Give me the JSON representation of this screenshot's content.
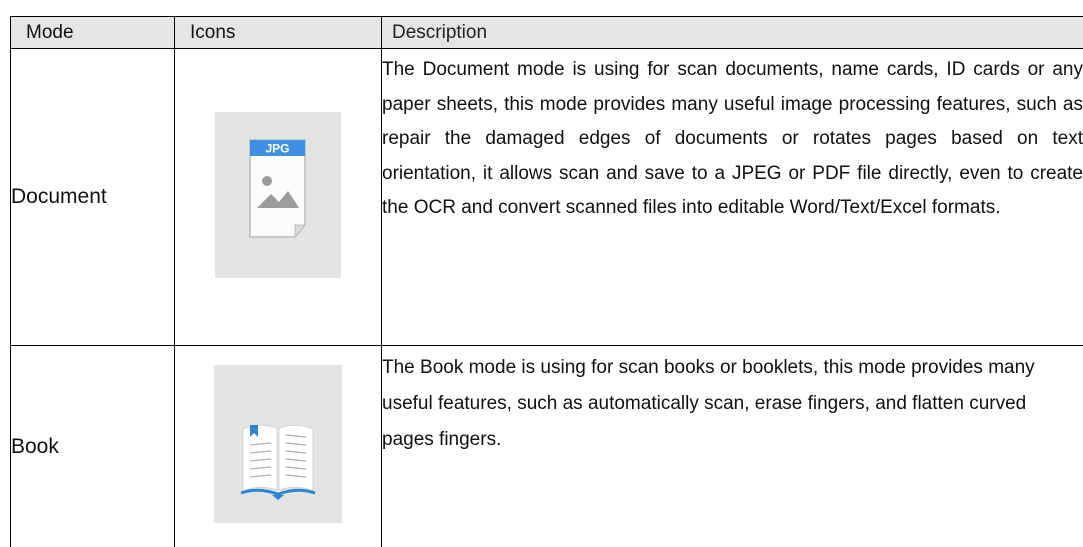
{
  "table": {
    "headers": {
      "mode": "Mode",
      "icons": "Icons",
      "description": "Description"
    },
    "rows": [
      {
        "mode": "Document",
        "icon": "jpg-file-icon",
        "icon_badge": "JPG",
        "description": "The Document mode is using for scan documents, name cards, ID cards or any paper sheets, this mode provides many useful image processing features, such as repair the damaged edges of documents or rotates pages based on text orientation, it allows scan and save to a JPEG or PDF file directly, even to create the OCR and convert scanned files into editable Word/Text/Excel formats."
      },
      {
        "mode": "Book",
        "icon": "open-book-icon",
        "description": "The Book mode is using for scan books or booklets, this mode provides many useful features, such as automatically scan, erase fingers, and flatten curved pages fingers."
      }
    ]
  },
  "colors": {
    "header_background": "#e5e5e5",
    "icon_tile_background": "#e4e4e4",
    "jpg_badge": "#3e8fe6",
    "book_blue": "#2a86d4"
  }
}
